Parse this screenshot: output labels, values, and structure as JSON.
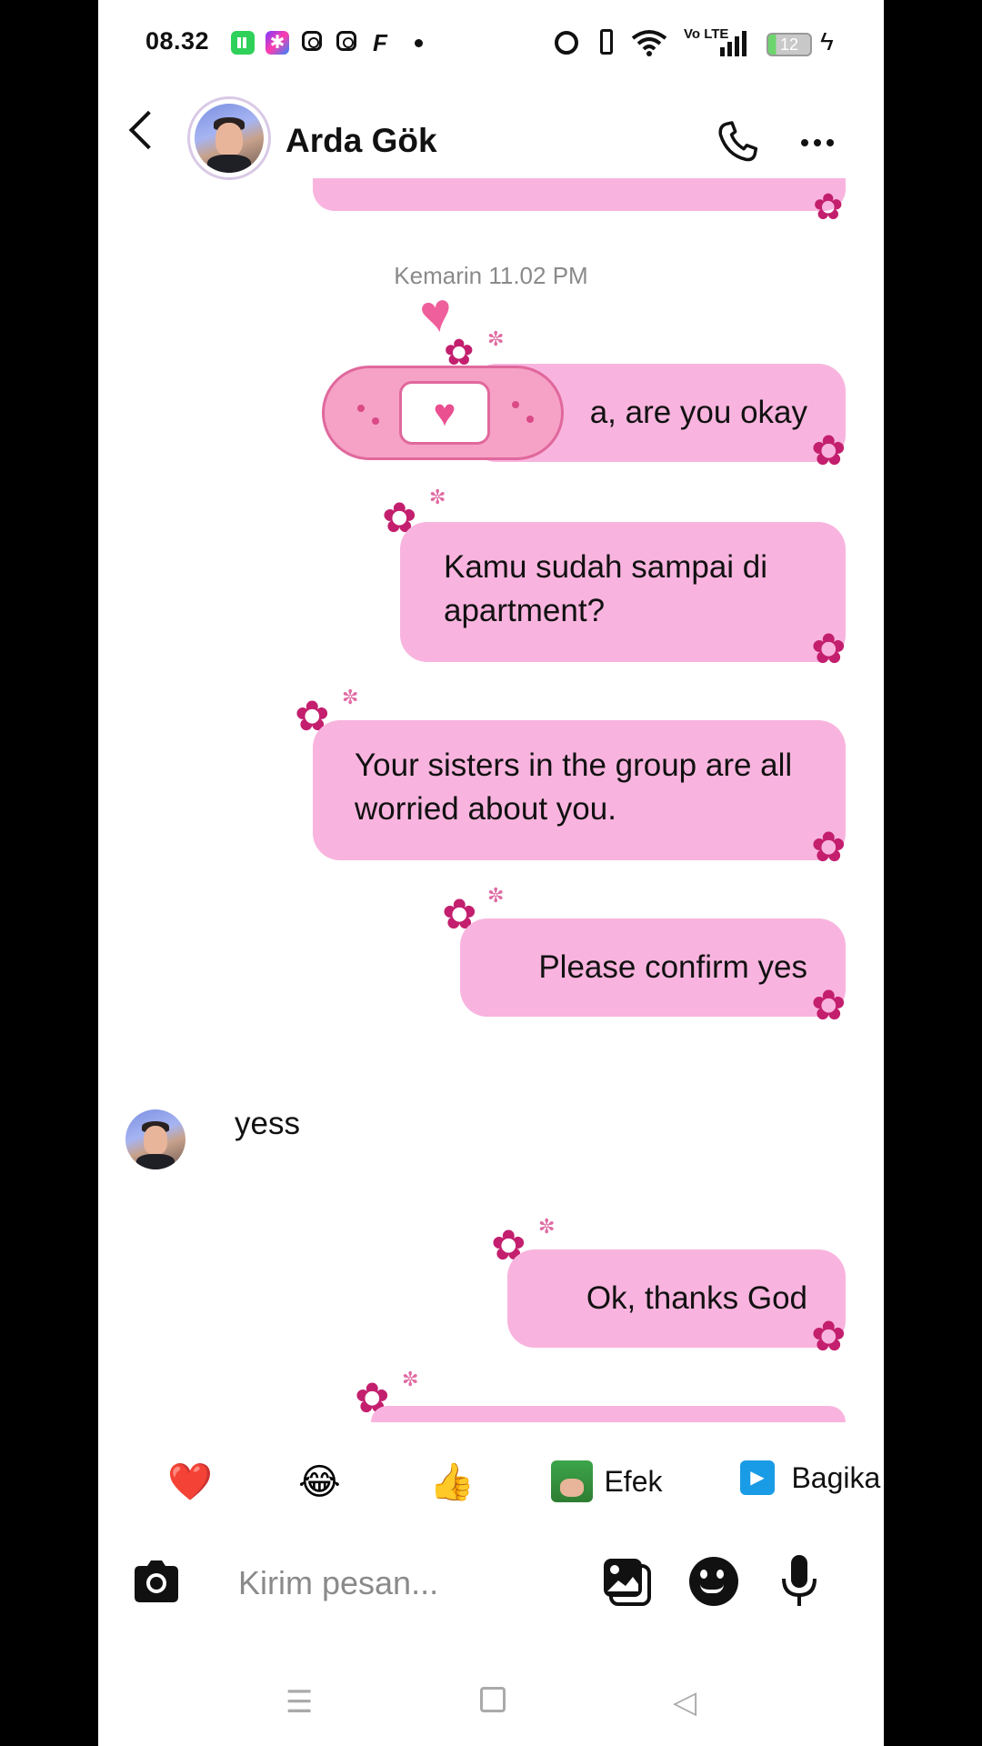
{
  "status_bar": {
    "time": "08.32",
    "app_icons": [
      "grid-app-icon",
      "pinwheel-app-icon",
      "instagram-icon",
      "instagram-icon",
      "f-app-icon"
    ],
    "battery": "12",
    "signal": "Vo LTE",
    "right_icons": [
      "alarm-icon",
      "vibrate-icon",
      "wifi-icon",
      "volte-icon",
      "signal-icon",
      "battery-icon",
      "charging-icon"
    ]
  },
  "header": {
    "contact_name": "Arda Gök"
  },
  "chat": {
    "timestamp": "Kemarin 11.02 PM",
    "messages": [
      {
        "direction": "sent",
        "text": "a, are you okay"
      },
      {
        "direction": "sent",
        "text": "Kamu sudah sampai di apartment?"
      },
      {
        "direction": "sent",
        "text": "Your sisters in the group are all worried about you."
      },
      {
        "direction": "sent",
        "text": "Please confirm yes"
      },
      {
        "direction": "received",
        "text": "yess"
      },
      {
        "direction": "sent",
        "text": "Ok, thanks God"
      }
    ]
  },
  "quick_replies": {
    "heart": "❤️",
    "laugh": "😂",
    "thumbs": "👍",
    "effect_label": "Efek",
    "share_label": "Bagika"
  },
  "composer": {
    "placeholder": "Kirim pesan..."
  },
  "colors": {
    "bubble": "#f8b4de",
    "flower": "#c31f6e",
    "bandage": "#f48fb8"
  }
}
